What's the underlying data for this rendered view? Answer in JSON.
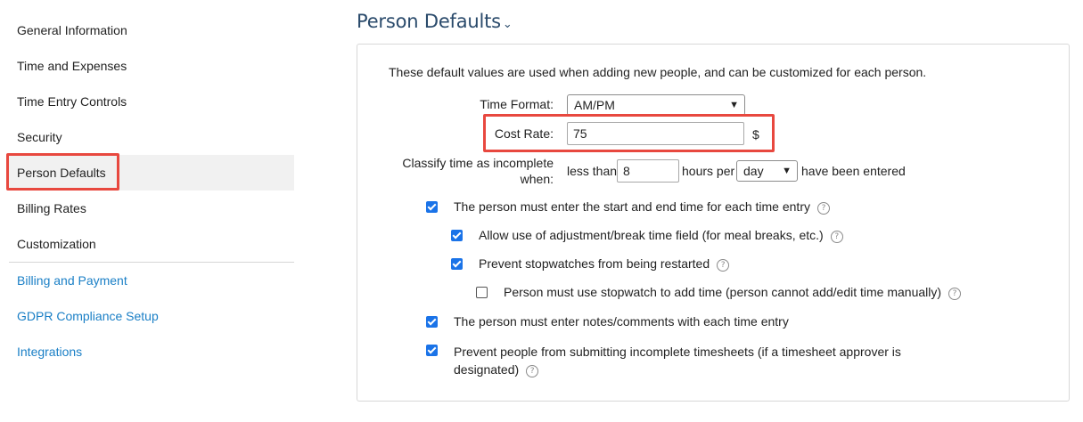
{
  "sidebar": {
    "items": [
      {
        "label": "General Information"
      },
      {
        "label": "Time and Expenses"
      },
      {
        "label": "Time Entry Controls"
      },
      {
        "label": "Security"
      },
      {
        "label": "Person Defaults"
      },
      {
        "label": "Billing Rates"
      },
      {
        "label": "Customization"
      }
    ],
    "links": [
      {
        "label": "Billing and Payment"
      },
      {
        "label": "GDPR Compliance Setup"
      },
      {
        "label": "Integrations"
      }
    ],
    "active_index": 4
  },
  "main": {
    "title": "Person Defaults",
    "title_icon": "chevron-down-icon",
    "intro": "These default values are used when adding new people, and can be customized for each person.",
    "time_format": {
      "label": "Time Format:",
      "value": "AM/PM"
    },
    "cost_rate": {
      "label": "Cost Rate:",
      "value": "75",
      "unit": "$"
    },
    "incomplete": {
      "label_line1": "Classify time as incomplete",
      "label_line2": "when:",
      "prefix": "less than",
      "hours_value": "8",
      "mid": "hours per",
      "period_value": "day",
      "suffix": "have been entered"
    },
    "checkboxes": [
      {
        "label": "The person must enter the start and end time for each time entry",
        "checked": true
      },
      {
        "label": "Allow use of adjustment/break time field (for meal breaks, etc.)",
        "checked": true
      },
      {
        "label": "Prevent stopwatches from being restarted",
        "checked": true
      },
      {
        "label": "Person must use stopwatch to add time (person cannot add/edit time manually)",
        "checked": false
      },
      {
        "label": "The person must enter notes/comments with each time entry",
        "checked": true
      },
      {
        "label_line1": "Prevent people from submitting incomplete timesheets (if a timesheet approver is",
        "label_line2": "designated)",
        "checked": true
      }
    ],
    "help_glyph": "?"
  },
  "colors": {
    "accent": "#1a73e8",
    "link": "#1a7fc6",
    "title": "#2a4a6b",
    "highlight": "#e8483f"
  }
}
